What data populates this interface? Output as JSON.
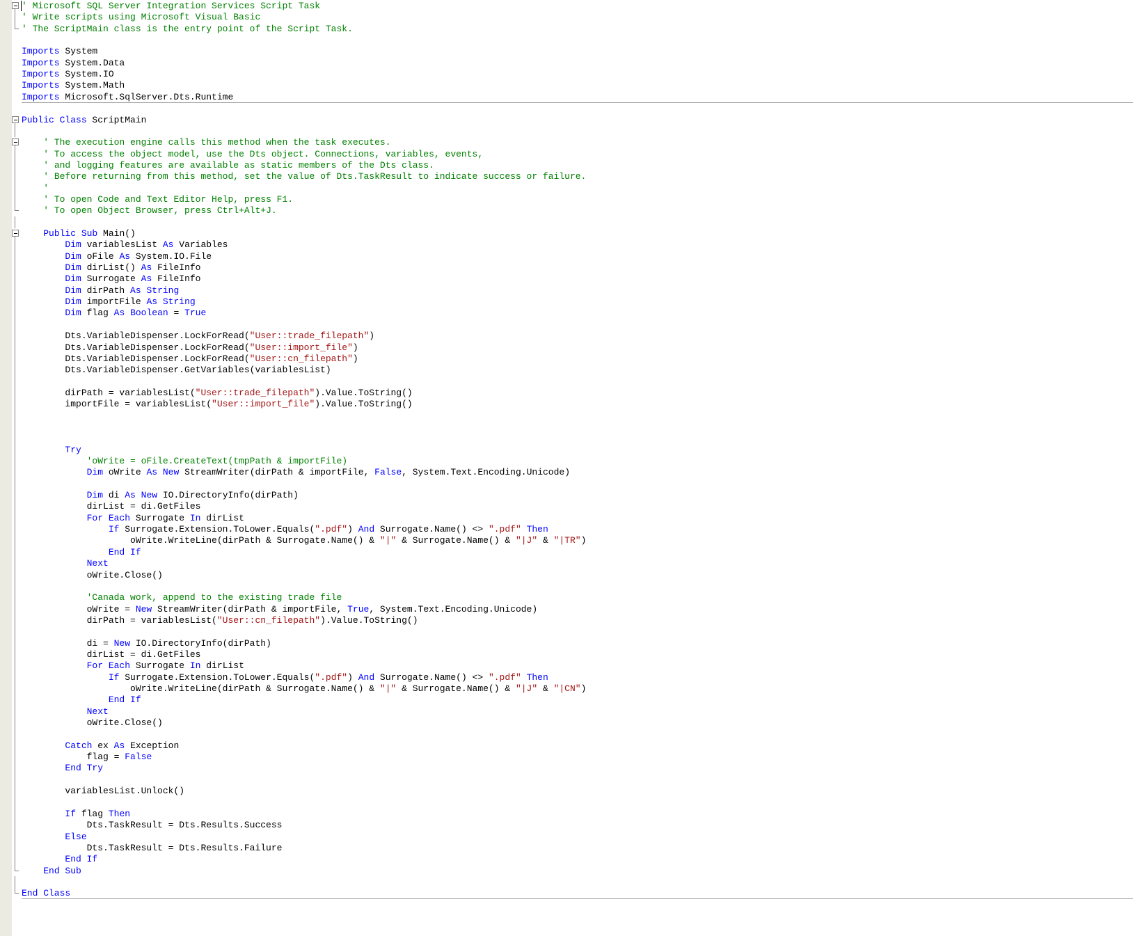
{
  "colors": {
    "keyword": "#0000ff",
    "comment": "#008000",
    "string": "#a31515",
    "plain": "#000000"
  },
  "lines": [
    {
      "fold": "open",
      "caret": true,
      "tokens": [
        [
          "c",
          "' Microsoft SQL Server Integration Services Script Task"
        ]
      ]
    },
    {
      "fold": "mid",
      "tokens": [
        [
          "c",
          "' Write scripts using Microsoft Visual Basic"
        ]
      ]
    },
    {
      "fold": "end",
      "tokens": [
        [
          "c",
          "' The ScriptMain class is the entry point of the Script Task."
        ]
      ]
    },
    {
      "tokens": []
    },
    {
      "tokens": [
        [
          "k",
          "Imports"
        ],
        [
          "p",
          " System"
        ]
      ]
    },
    {
      "tokens": [
        [
          "k",
          "Imports"
        ],
        [
          "p",
          " System.Data"
        ]
      ]
    },
    {
      "tokens": [
        [
          "k",
          "Imports"
        ],
        [
          "p",
          " System.IO"
        ]
      ]
    },
    {
      "tokens": [
        [
          "k",
          "Imports"
        ],
        [
          "p",
          " System.Math"
        ]
      ]
    },
    {
      "sep": true,
      "tokens": [
        [
          "k",
          "Imports"
        ],
        [
          "p",
          " Microsoft.SqlServer.Dts.Runtime"
        ]
      ]
    },
    {
      "tokens": []
    },
    {
      "fold": "open",
      "tokens": [
        [
          "k",
          "Public Class"
        ],
        [
          "p",
          " ScriptMain"
        ]
      ]
    },
    {
      "fold": "mid",
      "tokens": []
    },
    {
      "fold": "open",
      "tokens": [
        [
          "p",
          "    "
        ],
        [
          "c",
          "' The execution engine calls this method when the task executes."
        ]
      ]
    },
    {
      "fold": "mid",
      "tokens": [
        [
          "p",
          "    "
        ],
        [
          "c",
          "' To access the object model, use the Dts object. Connections, variables, events,"
        ]
      ]
    },
    {
      "fold": "mid",
      "tokens": [
        [
          "p",
          "    "
        ],
        [
          "c",
          "' and logging features are available as static members of the Dts class."
        ]
      ]
    },
    {
      "fold": "mid",
      "tokens": [
        [
          "p",
          "    "
        ],
        [
          "c",
          "' Before returning from this method, set the value of Dts.TaskResult to indicate success or failure."
        ]
      ]
    },
    {
      "fold": "mid",
      "tokens": [
        [
          "p",
          "    "
        ],
        [
          "c",
          "'"
        ]
      ]
    },
    {
      "fold": "mid",
      "tokens": [
        [
          "p",
          "    "
        ],
        [
          "c",
          "' To open Code and Text Editor Help, press F1."
        ]
      ]
    },
    {
      "fold": "end",
      "tokens": [
        [
          "p",
          "    "
        ],
        [
          "c",
          "' To open Object Browser, press Ctrl+Alt+J."
        ]
      ]
    },
    {
      "fold": "mid",
      "tokens": []
    },
    {
      "fold": "open",
      "tokens": [
        [
          "p",
          "    "
        ],
        [
          "k",
          "Public Sub"
        ],
        [
          "p",
          " Main()"
        ]
      ]
    },
    {
      "fold": "mid",
      "tokens": [
        [
          "p",
          "        "
        ],
        [
          "k",
          "Dim"
        ],
        [
          "p",
          " variablesList "
        ],
        [
          "k",
          "As"
        ],
        [
          "p",
          " Variables"
        ]
      ]
    },
    {
      "fold": "mid",
      "tokens": [
        [
          "p",
          "        "
        ],
        [
          "k",
          "Dim"
        ],
        [
          "p",
          " oFile "
        ],
        [
          "k",
          "As"
        ],
        [
          "p",
          " System.IO.File"
        ]
      ]
    },
    {
      "fold": "mid",
      "tokens": [
        [
          "p",
          "        "
        ],
        [
          "k",
          "Dim"
        ],
        [
          "p",
          " dirList() "
        ],
        [
          "k",
          "As"
        ],
        [
          "p",
          " FileInfo"
        ]
      ]
    },
    {
      "fold": "mid",
      "tokens": [
        [
          "p",
          "        "
        ],
        [
          "k",
          "Dim"
        ],
        [
          "p",
          " Surrogate "
        ],
        [
          "k",
          "As"
        ],
        [
          "p",
          " FileInfo"
        ]
      ]
    },
    {
      "fold": "mid",
      "tokens": [
        [
          "p",
          "        "
        ],
        [
          "k",
          "Dim"
        ],
        [
          "p",
          " dirPath "
        ],
        [
          "k",
          "As"
        ],
        [
          "p",
          " "
        ],
        [
          "k",
          "String"
        ]
      ]
    },
    {
      "fold": "mid",
      "tokens": [
        [
          "p",
          "        "
        ],
        [
          "k",
          "Dim"
        ],
        [
          "p",
          " importFile "
        ],
        [
          "k",
          "As"
        ],
        [
          "p",
          " "
        ],
        [
          "k",
          "String"
        ]
      ]
    },
    {
      "fold": "mid",
      "tokens": [
        [
          "p",
          "        "
        ],
        [
          "k",
          "Dim"
        ],
        [
          "p",
          " flag "
        ],
        [
          "k",
          "As"
        ],
        [
          "p",
          " "
        ],
        [
          "k",
          "Boolean"
        ],
        [
          "p",
          " = "
        ],
        [
          "k",
          "True"
        ]
      ]
    },
    {
      "fold": "mid",
      "tokens": []
    },
    {
      "fold": "mid",
      "tokens": [
        [
          "p",
          "        Dts.VariableDispenser.LockForRead("
        ],
        [
          "s",
          "\"User::trade_filepath\""
        ],
        [
          "p",
          ")"
        ]
      ]
    },
    {
      "fold": "mid",
      "tokens": [
        [
          "p",
          "        Dts.VariableDispenser.LockForRead("
        ],
        [
          "s",
          "\"User::import_file\""
        ],
        [
          "p",
          ")"
        ]
      ]
    },
    {
      "fold": "mid",
      "tokens": [
        [
          "p",
          "        Dts.VariableDispenser.LockForRead("
        ],
        [
          "s",
          "\"User::cn_filepath\""
        ],
        [
          "p",
          ")"
        ]
      ]
    },
    {
      "fold": "mid",
      "tokens": [
        [
          "p",
          "        Dts.VariableDispenser.GetVariables(variablesList)"
        ]
      ]
    },
    {
      "fold": "mid",
      "tokens": []
    },
    {
      "fold": "mid",
      "tokens": [
        [
          "p",
          "        dirPath = variablesList("
        ],
        [
          "s",
          "\"User::trade_filepath\""
        ],
        [
          "p",
          ").Value.ToString()"
        ]
      ]
    },
    {
      "fold": "mid",
      "tokens": [
        [
          "p",
          "        importFile = variablesList("
        ],
        [
          "s",
          "\"User::import_file\""
        ],
        [
          "p",
          ").Value.ToString()"
        ]
      ]
    },
    {
      "fold": "mid",
      "tokens": []
    },
    {
      "fold": "mid",
      "tokens": []
    },
    {
      "fold": "mid",
      "tokens": []
    },
    {
      "fold": "mid",
      "tokens": [
        [
          "p",
          "        "
        ],
        [
          "k",
          "Try"
        ]
      ]
    },
    {
      "fold": "mid",
      "tokens": [
        [
          "p",
          "            "
        ],
        [
          "c",
          "'oWrite = oFile.CreateText(tmpPath & importFile)"
        ]
      ]
    },
    {
      "fold": "mid",
      "tokens": [
        [
          "p",
          "            "
        ],
        [
          "k",
          "Dim"
        ],
        [
          "p",
          " oWrite "
        ],
        [
          "k",
          "As"
        ],
        [
          "p",
          " "
        ],
        [
          "k",
          "New"
        ],
        [
          "p",
          " StreamWriter(dirPath & importFile, "
        ],
        [
          "k",
          "False"
        ],
        [
          "p",
          ", System.Text.Encoding.Unicode)"
        ]
      ]
    },
    {
      "fold": "mid",
      "tokens": []
    },
    {
      "fold": "mid",
      "tokens": [
        [
          "p",
          "            "
        ],
        [
          "k",
          "Dim"
        ],
        [
          "p",
          " di "
        ],
        [
          "k",
          "As"
        ],
        [
          "p",
          " "
        ],
        [
          "k",
          "New"
        ],
        [
          "p",
          " IO.DirectoryInfo(dirPath)"
        ]
      ]
    },
    {
      "fold": "mid",
      "tokens": [
        [
          "p",
          "            dirList = di.GetFiles"
        ]
      ]
    },
    {
      "fold": "mid",
      "tokens": [
        [
          "p",
          "            "
        ],
        [
          "k",
          "For Each"
        ],
        [
          "p",
          " Surrogate "
        ],
        [
          "k",
          "In"
        ],
        [
          "p",
          " dirList"
        ]
      ]
    },
    {
      "fold": "mid",
      "tokens": [
        [
          "p",
          "                "
        ],
        [
          "k",
          "If"
        ],
        [
          "p",
          " Surrogate.Extension.ToLower.Equals("
        ],
        [
          "s",
          "\".pdf\""
        ],
        [
          "p",
          ") "
        ],
        [
          "k",
          "And"
        ],
        [
          "p",
          " Surrogate.Name() <> "
        ],
        [
          "s",
          "\".pdf\""
        ],
        [
          "p",
          " "
        ],
        [
          "k",
          "Then"
        ]
      ]
    },
    {
      "fold": "mid",
      "tokens": [
        [
          "p",
          "                    oWrite.WriteLine(dirPath & Surrogate.Name() & "
        ],
        [
          "s",
          "\"|\""
        ],
        [
          "p",
          " & Surrogate.Name() & "
        ],
        [
          "s",
          "\"|J\""
        ],
        [
          "p",
          " & "
        ],
        [
          "s",
          "\"|TR\""
        ],
        [
          "p",
          ")"
        ]
      ]
    },
    {
      "fold": "mid",
      "tokens": [
        [
          "p",
          "                "
        ],
        [
          "k",
          "End If"
        ]
      ]
    },
    {
      "fold": "mid",
      "tokens": [
        [
          "p",
          "            "
        ],
        [
          "k",
          "Next"
        ]
      ]
    },
    {
      "fold": "mid",
      "tokens": [
        [
          "p",
          "            oWrite.Close()"
        ]
      ]
    },
    {
      "fold": "mid",
      "tokens": []
    },
    {
      "fold": "mid",
      "tokens": [
        [
          "p",
          "            "
        ],
        [
          "c",
          "'Canada work, append to the existing trade file"
        ]
      ]
    },
    {
      "fold": "mid",
      "tokens": [
        [
          "p",
          "            oWrite = "
        ],
        [
          "k",
          "New"
        ],
        [
          "p",
          " StreamWriter(dirPath & importFile, "
        ],
        [
          "k",
          "True"
        ],
        [
          "p",
          ", System.Text.Encoding.Unicode)"
        ]
      ]
    },
    {
      "fold": "mid",
      "tokens": [
        [
          "p",
          "            dirPath = variablesList("
        ],
        [
          "s",
          "\"User::cn_filepath\""
        ],
        [
          "p",
          ").Value.ToString()"
        ]
      ]
    },
    {
      "fold": "mid",
      "tokens": []
    },
    {
      "fold": "mid",
      "tokens": [
        [
          "p",
          "            di = "
        ],
        [
          "k",
          "New"
        ],
        [
          "p",
          " IO.DirectoryInfo(dirPath)"
        ]
      ]
    },
    {
      "fold": "mid",
      "tokens": [
        [
          "p",
          "            dirList = di.GetFiles"
        ]
      ]
    },
    {
      "fold": "mid",
      "tokens": [
        [
          "p",
          "            "
        ],
        [
          "k",
          "For Each"
        ],
        [
          "p",
          " Surrogate "
        ],
        [
          "k",
          "In"
        ],
        [
          "p",
          " dirList"
        ]
      ]
    },
    {
      "fold": "mid",
      "tokens": [
        [
          "p",
          "                "
        ],
        [
          "k",
          "If"
        ],
        [
          "p",
          " Surrogate.Extension.ToLower.Equals("
        ],
        [
          "s",
          "\".pdf\""
        ],
        [
          "p",
          ") "
        ],
        [
          "k",
          "And"
        ],
        [
          "p",
          " Surrogate.Name() <> "
        ],
        [
          "s",
          "\".pdf\""
        ],
        [
          "p",
          " "
        ],
        [
          "k",
          "Then"
        ]
      ]
    },
    {
      "fold": "mid",
      "tokens": [
        [
          "p",
          "                    oWrite.WriteLine(dirPath & Surrogate.Name() & "
        ],
        [
          "s",
          "\"|\""
        ],
        [
          "p",
          " & Surrogate.Name() & "
        ],
        [
          "s",
          "\"|J\""
        ],
        [
          "p",
          " & "
        ],
        [
          "s",
          "\"|CN\""
        ],
        [
          "p",
          ")"
        ]
      ]
    },
    {
      "fold": "mid",
      "tokens": [
        [
          "p",
          "                "
        ],
        [
          "k",
          "End If"
        ]
      ]
    },
    {
      "fold": "mid",
      "tokens": [
        [
          "p",
          "            "
        ],
        [
          "k",
          "Next"
        ]
      ]
    },
    {
      "fold": "mid",
      "tokens": [
        [
          "p",
          "            oWrite.Close()"
        ]
      ]
    },
    {
      "fold": "mid",
      "tokens": []
    },
    {
      "fold": "mid",
      "tokens": [
        [
          "p",
          "        "
        ],
        [
          "k",
          "Catch"
        ],
        [
          "p",
          " ex "
        ],
        [
          "k",
          "As"
        ],
        [
          "p",
          " Exception"
        ]
      ]
    },
    {
      "fold": "mid",
      "tokens": [
        [
          "p",
          "            flag = "
        ],
        [
          "k",
          "False"
        ]
      ]
    },
    {
      "fold": "mid",
      "tokens": [
        [
          "p",
          "        "
        ],
        [
          "k",
          "End Try"
        ]
      ]
    },
    {
      "fold": "mid",
      "tokens": []
    },
    {
      "fold": "mid",
      "tokens": [
        [
          "p",
          "        variablesList.Unlock()"
        ]
      ]
    },
    {
      "fold": "mid",
      "tokens": []
    },
    {
      "fold": "mid",
      "tokens": [
        [
          "p",
          "        "
        ],
        [
          "k",
          "If"
        ],
        [
          "p",
          " flag "
        ],
        [
          "k",
          "Then"
        ]
      ]
    },
    {
      "fold": "mid",
      "tokens": [
        [
          "p",
          "            Dts.TaskResult = Dts.Results.Success"
        ]
      ]
    },
    {
      "fold": "mid",
      "tokens": [
        [
          "p",
          "        "
        ],
        [
          "k",
          "Else"
        ]
      ]
    },
    {
      "fold": "mid",
      "tokens": [
        [
          "p",
          "            Dts.TaskResult = Dts.Results.Failure"
        ]
      ]
    },
    {
      "fold": "mid",
      "tokens": [
        [
          "p",
          "        "
        ],
        [
          "k",
          "End If"
        ]
      ]
    },
    {
      "fold": "end",
      "tokens": [
        [
          "p",
          "    "
        ],
        [
          "k",
          "End Sub"
        ]
      ]
    },
    {
      "fold": "mid",
      "tokens": []
    },
    {
      "fold": "end",
      "sep": true,
      "tokens": [
        [
          "k",
          "End Class"
        ]
      ]
    }
  ]
}
